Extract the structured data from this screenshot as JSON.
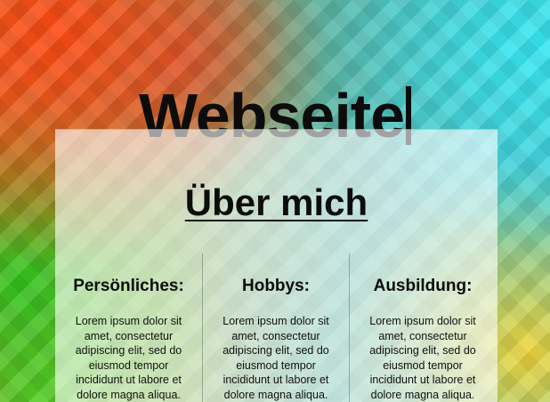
{
  "header": {
    "title": "Webseite"
  },
  "about": {
    "heading": "Über mich",
    "columns": [
      {
        "title": "Persönliches:",
        "text": "Lorem ipsum dolor sit amet, consectetur adipiscing elit, sed do eiusmod tempor incididunt ut labore et dolore magna aliqua."
      },
      {
        "title": "Hobbys:",
        "text": "Lorem ipsum dolor sit amet, consectetur adipiscing elit, sed do eiusmod tempor incididunt ut labore et dolore magna aliqua."
      },
      {
        "title": "Ausbildung:",
        "text": "Lorem ipsum dolor sit amet, consectetur adipiscing elit, sed do eiusmod tempor incididunt ut labore et dolore magna aliqua."
      }
    ]
  },
  "colors": {
    "text": "#0c0c0c",
    "card_background": "rgba(255,255,255,0.62)"
  }
}
